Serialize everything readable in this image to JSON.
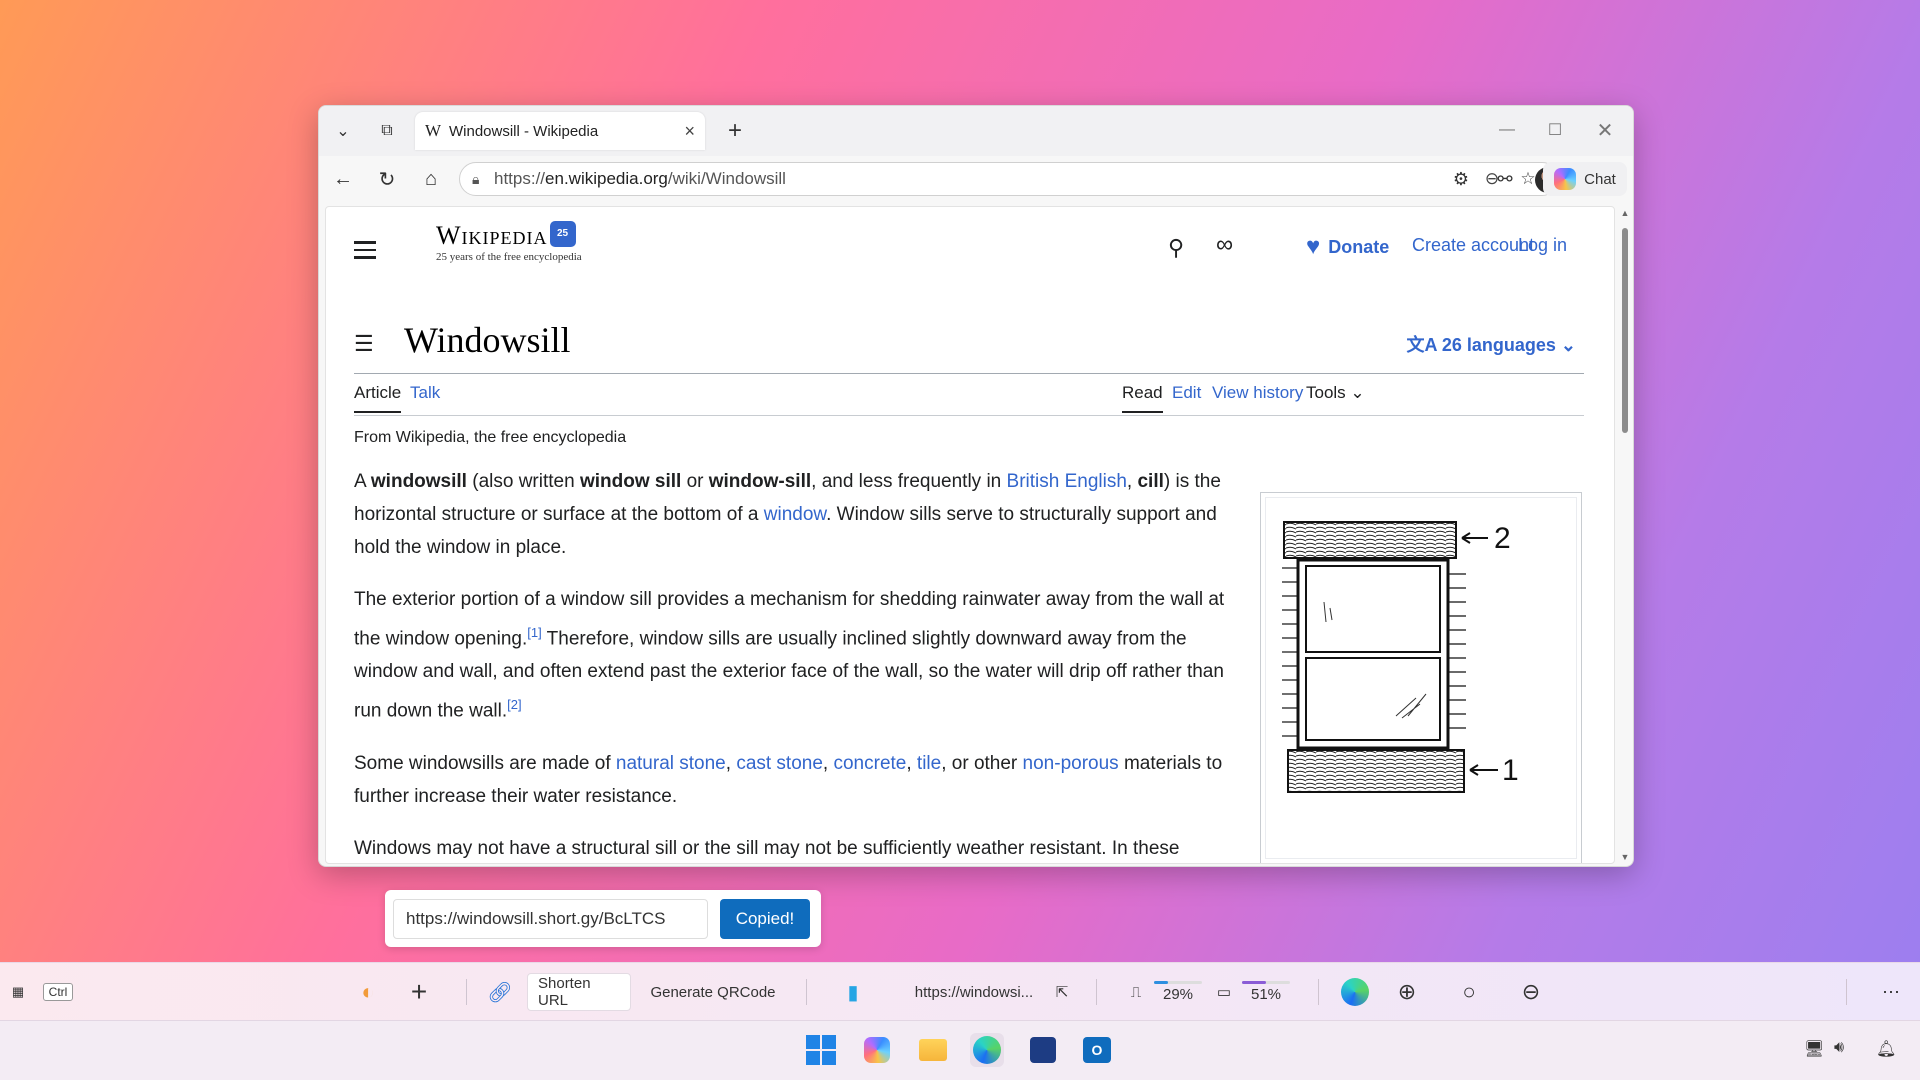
{
  "browser": {
    "tab_title": "Windowsill - Wikipedia",
    "tab_favicon": "W",
    "url_prefix": "https://",
    "url_domain": "en.wikipedia.org",
    "url_path": "/wiki/Windowsill",
    "chat_label": "Chat"
  },
  "wiki": {
    "logo_word": "Wikipedia",
    "logo_badge": "25",
    "logo_tagline": "25 years of the free encyclopedia",
    "donate": "Donate",
    "create_account": "Create account",
    "login": "Log in",
    "title": "Windowsill",
    "languages": "26 languages",
    "tab_article": "Article",
    "tab_talk": "Talk",
    "tab_read": "Read",
    "tab_edit": "Edit",
    "tab_history": "View history",
    "tab_tools": "Tools",
    "from": "From Wikipedia, the free encyclopedia",
    "p1": {
      "t1": "A ",
      "b1": "windowsill",
      "t2": " (also written ",
      "b2": "window sill",
      "t3": " or ",
      "b3": "window-sill",
      "t4": ", and less frequently in ",
      "l1": "British English",
      "t5": ", ",
      "b4": "cill",
      "t6": ") is the horizontal structure or surface at the bottom of a ",
      "l2": "window",
      "t7": ". Window sills serve to structurally support and hold the window in place."
    },
    "p2": {
      "t1": "The exterior portion of a window sill provides a mechanism for shedding rainwater away from the wall at the window opening.",
      "r1": "[1]",
      "t2": " Therefore, window sills are usually inclined slightly downward away from the window and wall, and often extend past the exterior face of the wall, so the water will drip off rather than run down the wall.",
      "r2": "[2]"
    },
    "p3": {
      "t1": "Some windowsills are made of ",
      "l1": "natural stone",
      "s1": ", ",
      "l2": "cast stone",
      "s2": ", ",
      "l3": "concrete",
      "s3": ", ",
      "l4": "tile",
      "t2": ", or other ",
      "l5": "non-porous",
      "t3": " materials to further increase their water resistance."
    },
    "p4": "Windows may not have a structural sill or the sill may not be sufficiently weather resistant. In these",
    "figure_label_top": "2",
    "figure_label_bottom": "1"
  },
  "shortener": {
    "short_url": "https://windowsill.short.gy/BcLTCS",
    "copied_label": "Copied!"
  },
  "bottombar": {
    "ctrl_key": "Ctrl",
    "shorten": "Shorten URL",
    "qrcode": "Generate QRCode",
    "link_text": "https://windowsi...",
    "cpu": "29%",
    "memory": "51%",
    "cpu_level": 0.29,
    "memory_level": 0.51
  },
  "colors": {
    "link": "#3366cc",
    "copied_bg": "#0f6cbd",
    "cpu_bar": "#2e8fe0",
    "memory_bar": "#8a5cd6"
  }
}
